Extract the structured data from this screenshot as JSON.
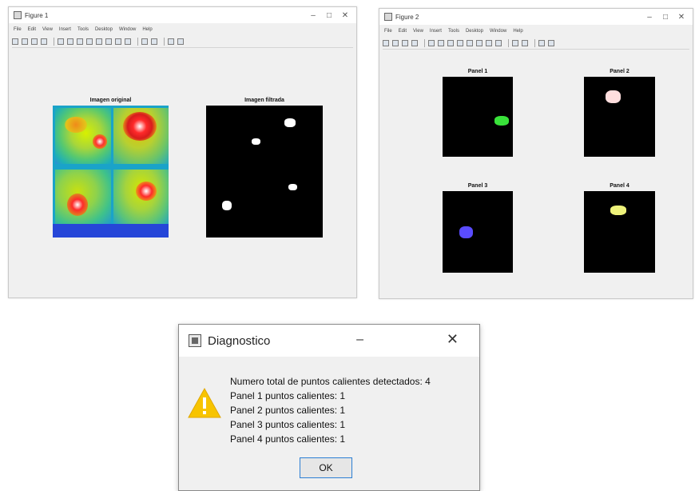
{
  "figure1": {
    "title": "Figure 1",
    "menu": [
      "File",
      "Edit",
      "View",
      "Insert",
      "Tools",
      "Desktop",
      "Window",
      "Help"
    ],
    "controls": {
      "minimize": "–",
      "maximize": "□",
      "close": "✕"
    },
    "original_title": "Imagen original",
    "filtered_title": "Imagen filtrada"
  },
  "figure2": {
    "title": "Figure 2",
    "menu": [
      "File",
      "Edit",
      "View",
      "Insert",
      "Tools",
      "Desktop",
      "Window",
      "Help"
    ],
    "controls": {
      "minimize": "–",
      "maximize": "□",
      "close": "✕"
    },
    "panels": [
      {
        "title": "Panel 1",
        "color": "#39e23a"
      },
      {
        "title": "Panel 2",
        "color": "#ffdede"
      },
      {
        "title": "Panel 3",
        "color": "#5a4cff"
      },
      {
        "title": "Panel 4",
        "color": "#eef27a"
      }
    ]
  },
  "dialog": {
    "title": "Diagnostico",
    "minimize": "–",
    "close": "✕",
    "lines": [
      "Numero total de puntos calientes detectados: 4",
      "Panel 1 puntos calientes: 1",
      "Panel 2 puntos calientes: 1",
      "Panel 3 puntos calientes: 1",
      "Panel 4 puntos calientes: 1"
    ],
    "ok_label": "OK"
  }
}
